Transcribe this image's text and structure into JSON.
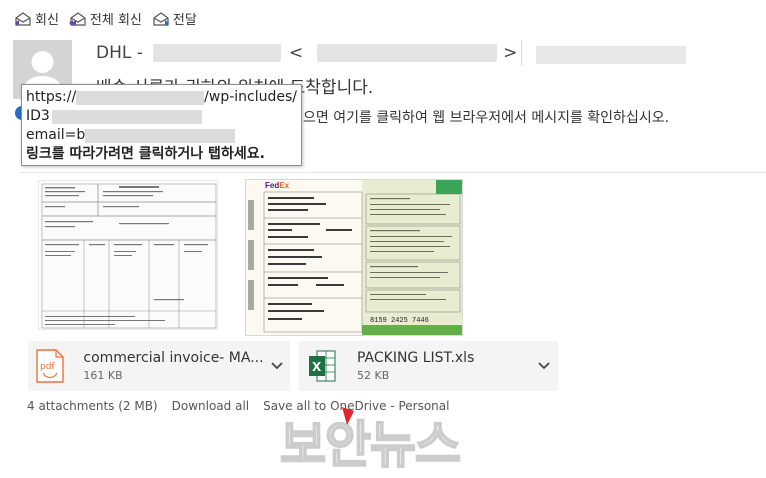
{
  "toolbar": {
    "reply": "회신",
    "reply_all": "전체 회신",
    "forward": "전달"
  },
  "header": {
    "sender_name": "DHL -",
    "email_open": "<",
    "email_close": ">",
    "subject": "배송 서류가 귀하의 위치에 도착합니다.",
    "info_text": "으면 여기를 클릭하여 웹 브라우저에서 메시지를 확인하십시오."
  },
  "tooltip": {
    "line1_start": "https://",
    "line1_end": "/wp-includes/",
    "line2": "ID3",
    "line3": "email=b",
    "line4": "링크를 따라가려면 클릭하거나 탭하세요."
  },
  "attachments": [
    {
      "name": "commercial invoice- MA...",
      "size": "161 KB",
      "icon": "pdf-icon",
      "icon_text": "pdf"
    },
    {
      "name": "PACKING LIST.xls",
      "size": "52 KB",
      "icon": "excel-icon",
      "icon_text": "X"
    }
  ],
  "thumb_fedex": {
    "brand": "FedEx",
    "tracking": "8159 2425 7446"
  },
  "footer": {
    "count": "4 attachments (2 MB)",
    "download_all": "Download all",
    "save_all": "Save all to OneDrive - Personal"
  },
  "watermark": "보안뉴스",
  "colors": {
    "accent": "#2b6cc4",
    "pdf": "#e8733d",
    "excel": "#1e7145",
    "fedex_purple": "#4d148c",
    "fedex_orange": "#ff6200",
    "watermark_tip": "#e0262c"
  }
}
